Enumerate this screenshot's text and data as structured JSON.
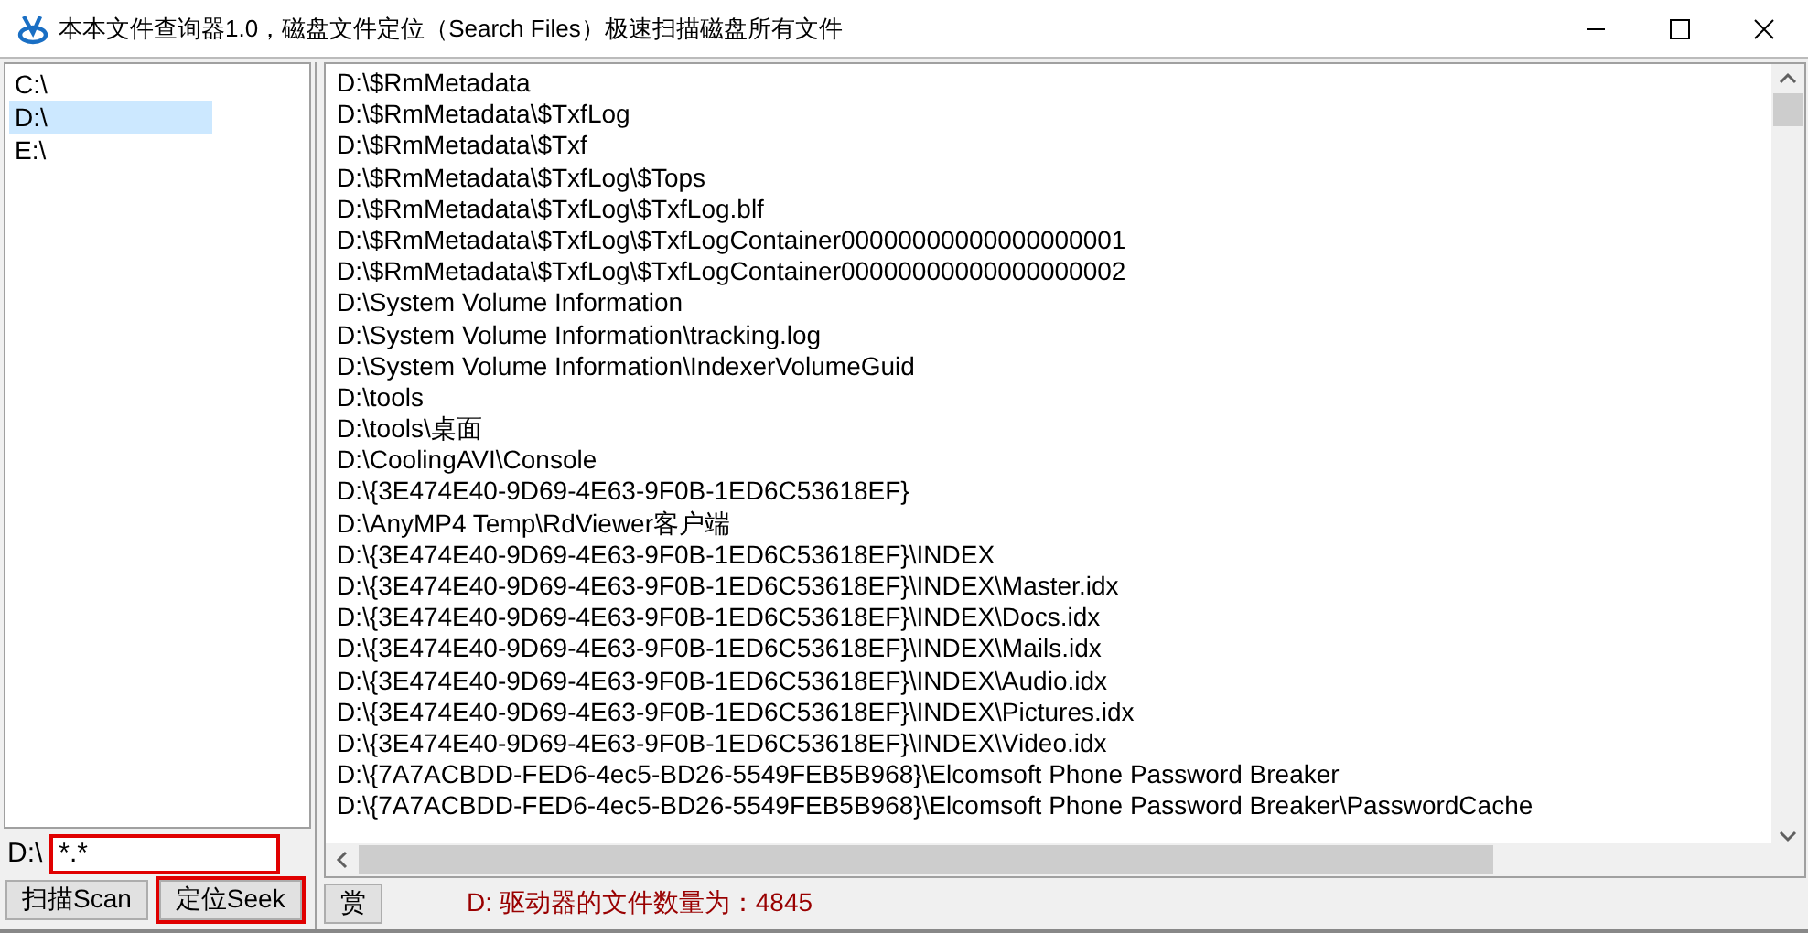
{
  "window": {
    "title": "本本文件查询器1.0，磁盘文件定位（Search Files）极速扫描磁盘所有文件"
  },
  "drives": [
    {
      "label": "C:\\",
      "selected": false
    },
    {
      "label": "D:\\",
      "selected": true
    },
    {
      "label": "E:\\",
      "selected": false
    }
  ],
  "path_label": "D:\\",
  "pattern": {
    "value": "*.*",
    "highlighted": true
  },
  "buttons": [
    {
      "label": "扫描Scan",
      "highlighted": false
    },
    {
      "label": "定位Seek",
      "highlighted": true
    }
  ],
  "files": [
    "D:\\$RmMetadata",
    "D:\\$RmMetadata\\$TxfLog",
    "D:\\$RmMetadata\\$Txf",
    "D:\\$RmMetadata\\$TxfLog\\$Tops",
    "D:\\$RmMetadata\\$TxfLog\\$TxfLog.blf",
    "D:\\$RmMetadata\\$TxfLog\\$TxfLogContainer00000000000000000001",
    "D:\\$RmMetadata\\$TxfLog\\$TxfLogContainer00000000000000000002",
    "D:\\System Volume Information",
    "D:\\System Volume Information\\tracking.log",
    "D:\\System Volume Information\\IndexerVolumeGuid",
    "D:\\tools",
    "D:\\tools\\桌面",
    "D:\\CoolingAVI\\Console",
    "D:\\{3E474E40-9D69-4E63-9F0B-1ED6C53618EF}",
    "D:\\AnyMP4 Temp\\RdViewer客户端",
    "D:\\{3E474E40-9D69-4E63-9F0B-1ED6C53618EF}\\INDEX",
    "D:\\{3E474E40-9D69-4E63-9F0B-1ED6C53618EF}\\INDEX\\Master.idx",
    "D:\\{3E474E40-9D69-4E63-9F0B-1ED6C53618EF}\\INDEX\\Docs.idx",
    "D:\\{3E474E40-9D69-4E63-9F0B-1ED6C53618EF}\\INDEX\\Mails.idx",
    "D:\\{3E474E40-9D69-4E63-9F0B-1ED6C53618EF}\\INDEX\\Audio.idx",
    "D:\\{3E474E40-9D69-4E63-9F0B-1ED6C53618EF}\\INDEX\\Pictures.idx",
    "D:\\{3E474E40-9D69-4E63-9F0B-1ED6C53618EF}\\INDEX\\Video.idx",
    "D:\\{7A7ACBDD-FED6-4ec5-BD26-5549FEB5B968}\\Elcomsoft Phone Password Breaker",
    "D:\\{7A7ACBDD-FED6-4ec5-BD26-5549FEB5B968}\\Elcomsoft Phone Password Breaker\\PasswordCache"
  ],
  "reward_button": "赏",
  "status": "D: 驱动器的文件数量为：4845"
}
